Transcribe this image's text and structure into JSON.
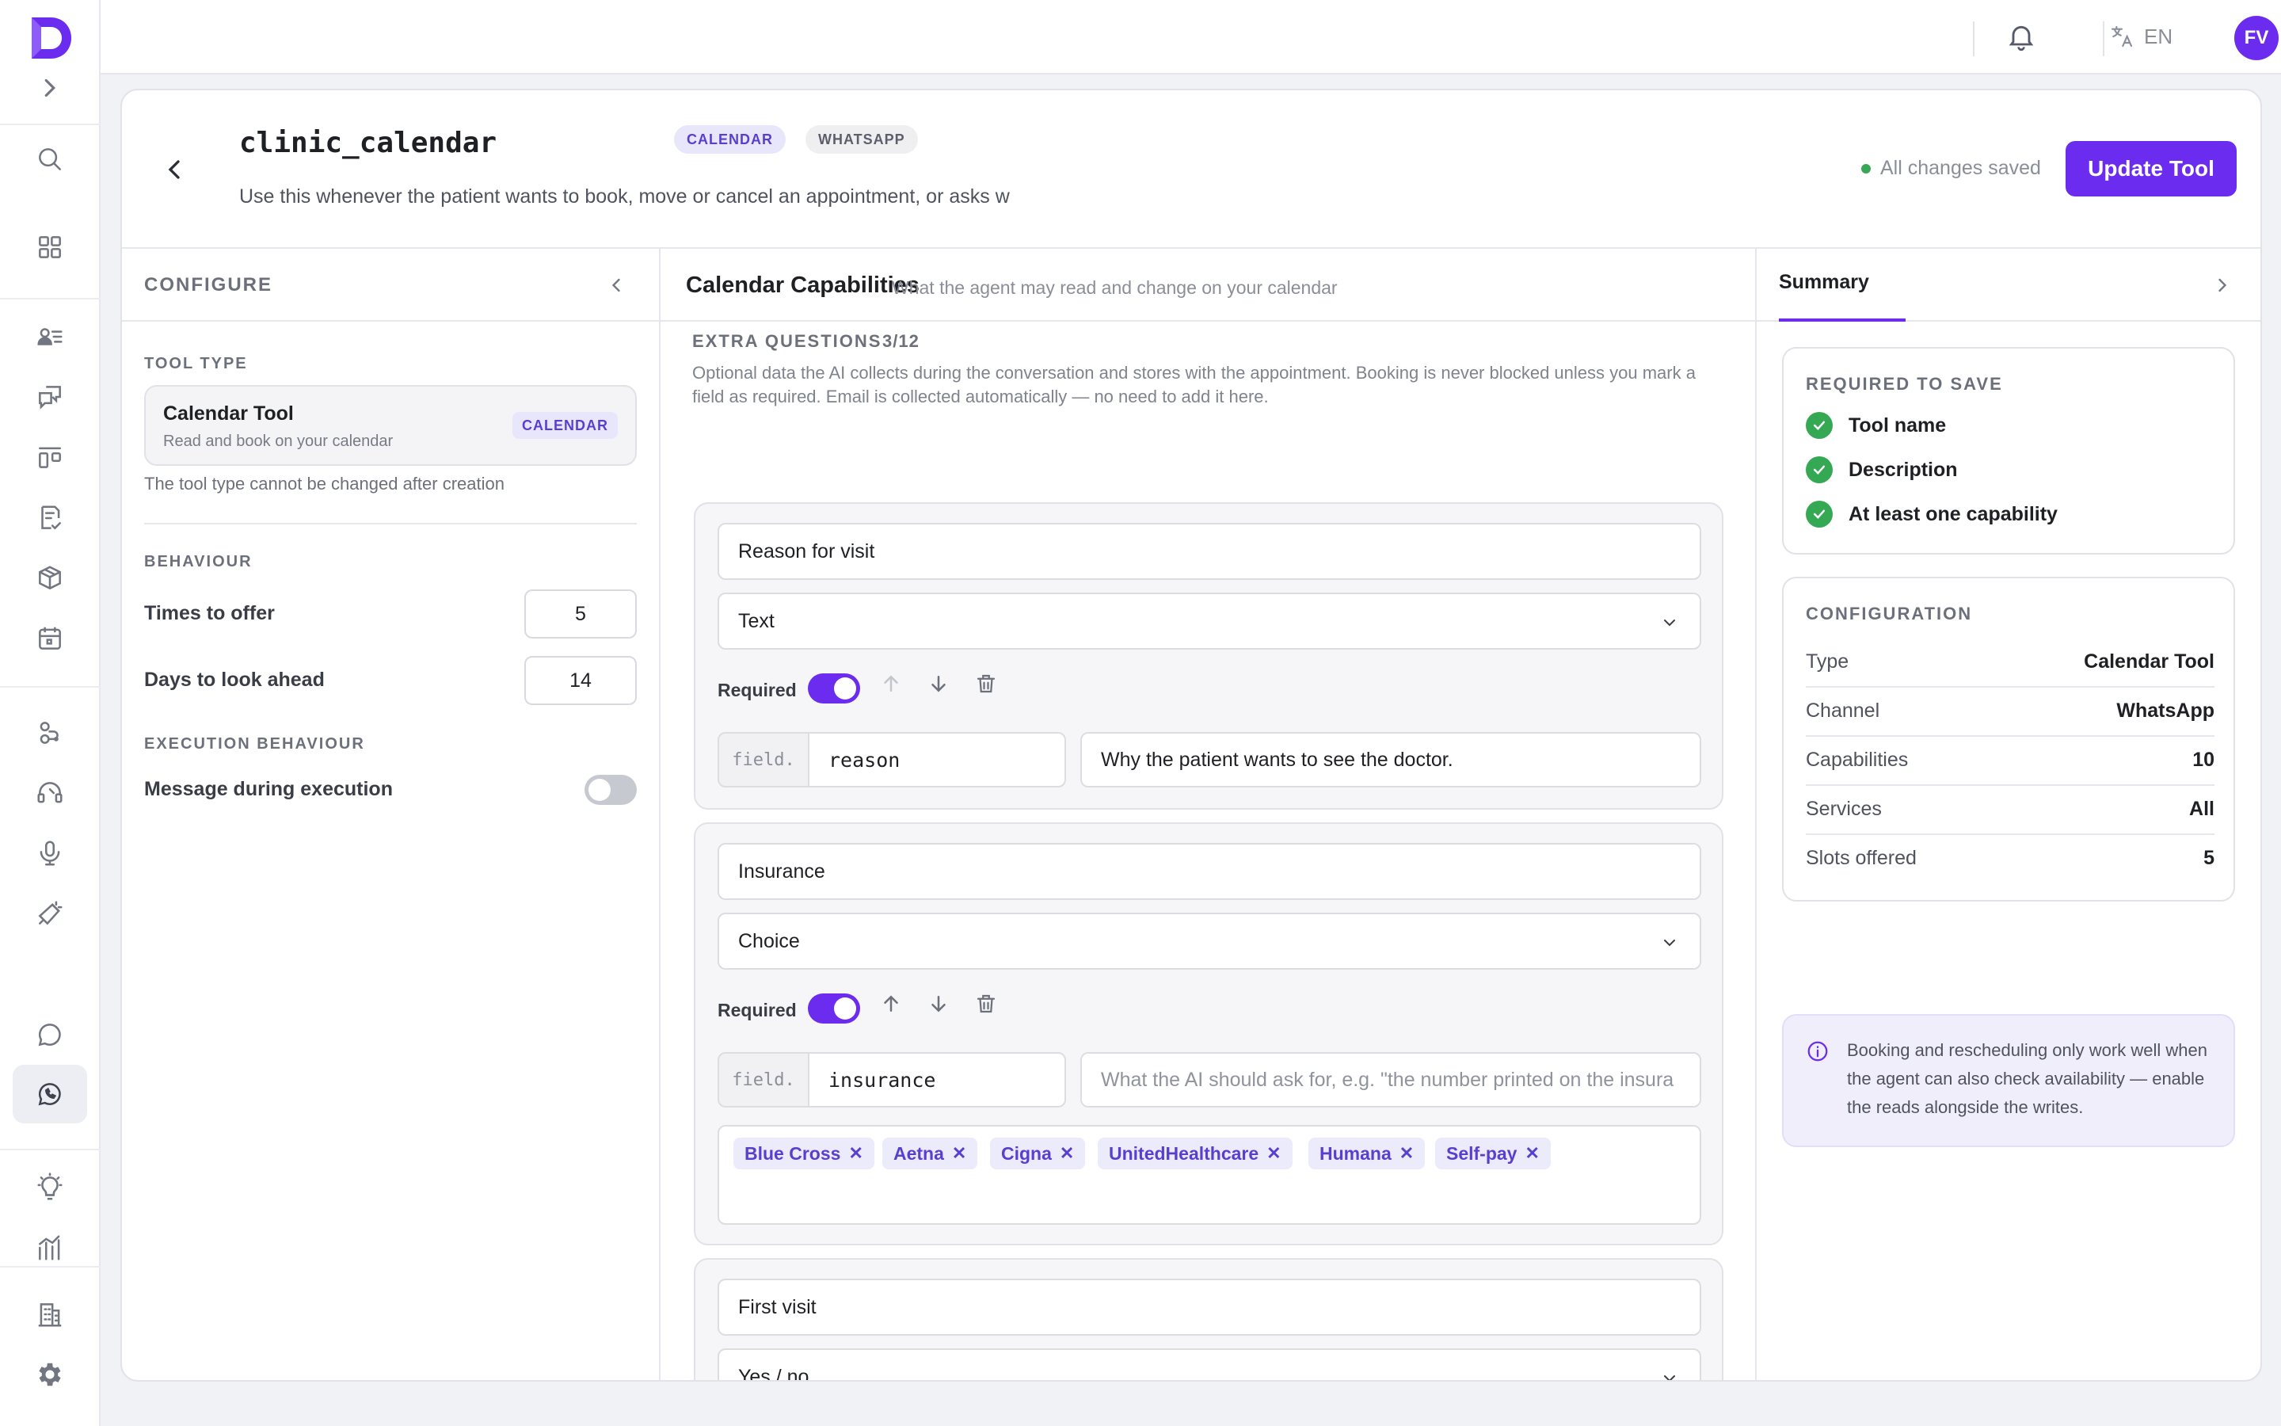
{
  "topbar": {
    "language": "EN",
    "avatar_initials": "FV"
  },
  "tool": {
    "name": "clinic_calendar",
    "tags": [
      "CALENDAR",
      "WHATSAPP"
    ],
    "description": "Use this whenever the patient wants to book, move or cancel an appointment, or asks w",
    "save_status": "All changes saved",
    "update_label": "Update Tool"
  },
  "configure": {
    "header": "CONFIGURE",
    "tool_type_label": "TOOL TYPE",
    "tool_type_title": "Calendar Tool",
    "tool_type_sub": "Read and book on your calendar",
    "tool_type_badge": "CALENDAR",
    "tool_type_note": "The tool type cannot be changed after creation",
    "behaviour_label": "BEHAVIOUR",
    "times_to_offer_label": "Times to offer",
    "times_to_offer_value": "5",
    "days_ahead_label": "Days to look ahead",
    "days_ahead_value": "14",
    "execution_label": "EXECUTION BEHAVIOUR",
    "message_during_execution_label": "Message during execution",
    "message_during_execution_on": false
  },
  "capabilities": {
    "title": "Calendar Capabilities",
    "subtitle": "What the agent may read and change on your calendar",
    "extra_questions_label": "EXTRA QUESTIONS",
    "extra_questions_count": "3/12",
    "extra_questions_desc": "Optional data the AI collects during the conversation and stores with the appointment. Booking is never blocked unless you mark a field as required. Email is collected automatically — no need to add it here.",
    "required_label": "Required",
    "field_prefix": "field.",
    "questions": [
      {
        "label": "Reason for visit",
        "type": "Text",
        "required": true,
        "key": "reason",
        "prompt": "Why the patient wants to see the doctor.",
        "prompt_placeholder": "",
        "options": []
      },
      {
        "label": "Insurance",
        "type": "Choice",
        "required": true,
        "key": "insurance",
        "prompt": "",
        "prompt_placeholder": "What the AI should ask for, e.g. \"the number printed on the insura",
        "options": [
          "Blue Cross",
          "Aetna",
          "Cigna",
          "UnitedHealthcare",
          "Humana",
          "Self-pay"
        ]
      },
      {
        "label": "First visit",
        "type": "Yes / no",
        "required": false,
        "key": "",
        "prompt": "",
        "prompt_placeholder": "",
        "options": []
      }
    ]
  },
  "summary": {
    "tab_label": "Summary",
    "required_label": "REQUIRED TO SAVE",
    "required_items": [
      "Tool name",
      "Description",
      "At least one capability"
    ],
    "configuration_label": "CONFIGURATION",
    "config_rows": [
      {
        "k": "Type",
        "v": "Calendar Tool"
      },
      {
        "k": "Channel",
        "v": "WhatsApp"
      },
      {
        "k": "Capabilities",
        "v": "10"
      },
      {
        "k": "Services",
        "v": "All"
      },
      {
        "k": "Slots offered",
        "v": "5"
      }
    ],
    "info_text": "Booking and rescheduling only work well when the agent can also check availability — enable the reads alongside the writes."
  },
  "colors": {
    "accent": "#6b2cf0",
    "success": "#34a853"
  }
}
